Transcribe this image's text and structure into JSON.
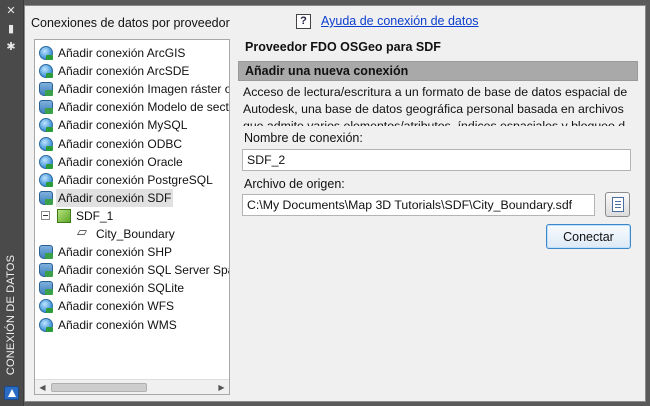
{
  "palette": {
    "vertical_title": "CONEXIÓN DE DATOS",
    "icons": [
      "close-icon",
      "pin-icon",
      "settings-icon",
      "autodesk-logo"
    ]
  },
  "providers": {
    "title": "Conexiones de datos por proveedor",
    "items": [
      {
        "label": "Añadir conexión ArcGIS",
        "icon": "globe"
      },
      {
        "label": "Añadir conexión ArcSDE",
        "icon": "globe"
      },
      {
        "label": "Añadir conexión Imagen ráster o",
        "icon": "db"
      },
      {
        "label": "Añadir conexión Modelo de secto",
        "icon": "db"
      },
      {
        "label": "Añadir conexión MySQL",
        "icon": "globe"
      },
      {
        "label": "Añadir conexión ODBC",
        "icon": "globe"
      },
      {
        "label": "Añadir conexión Oracle",
        "icon": "globe"
      },
      {
        "label": "Añadir conexión PostgreSQL",
        "icon": "globe"
      },
      {
        "label": "Añadir conexión SDF",
        "icon": "db",
        "selected": true
      },
      {
        "label": "SDF_1",
        "icon": "cube",
        "child": 1
      },
      {
        "label": "City_Boundary",
        "icon": "shape",
        "child": 2
      },
      {
        "label": "Añadir conexión SHP",
        "icon": "db"
      },
      {
        "label": "Añadir conexión SQL Server Spa",
        "icon": "db"
      },
      {
        "label": "Añadir conexión SQLite",
        "icon": "db"
      },
      {
        "label": "Añadir conexión WFS",
        "icon": "globe"
      },
      {
        "label": "Añadir conexión WMS",
        "icon": "globe"
      }
    ]
  },
  "help": {
    "icon_text": "?",
    "link_text": "Ayuda de conexión de datos"
  },
  "form": {
    "provider_title": "Proveedor FDO OSGeo para SDF",
    "section_title": "Añadir una nueva conexión",
    "description": "Acceso de lectura/escritura a un formato de base de datos espacial de Autodesk, una base de datos geográfica personal basada en archivos que admite varios elementos/atributos, índices espaciales y bloqueo d",
    "connection_name_label": "Nombre de conexión:",
    "connection_name_value": "SDF_2",
    "source_file_label": "Archivo de origen:",
    "source_file_value": "C:\\My Documents\\Map 3D Tutorials\\SDF\\City_Boundary.sdf",
    "connect_label": "Conectar"
  }
}
